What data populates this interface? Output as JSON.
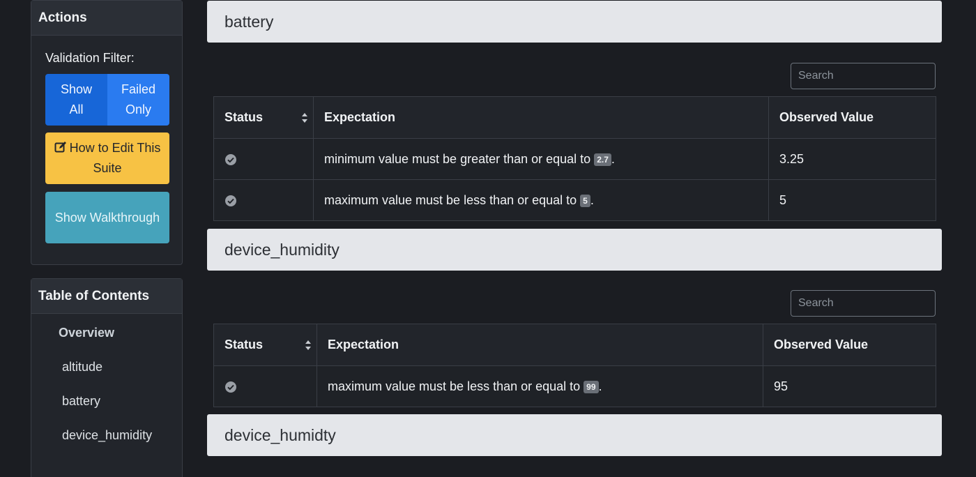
{
  "sidebar": {
    "actions": {
      "title": "Actions",
      "filter_label": "Validation Filter:",
      "show_all_label": "Show\nAll",
      "failed_only_label": "Failed\nOnly",
      "edit_label": "How to Edit This Suite",
      "walkthrough_label": "Show Walkthrough"
    },
    "toc": {
      "title": "Table of Contents",
      "items": [
        {
          "label": "Overview"
        },
        {
          "label": "altitude"
        },
        {
          "label": "battery"
        },
        {
          "label": "device_humidity"
        }
      ]
    }
  },
  "sections": [
    {
      "title": "battery",
      "search_placeholder": "Search",
      "columns": [
        "Status",
        "Expectation",
        "Observed Value"
      ],
      "rows": [
        {
          "status": "success",
          "expectation_prefix": "minimum value must be greater than or equal to ",
          "param": "2.7",
          "expectation_suffix": ".",
          "observed": "3.25"
        },
        {
          "status": "success",
          "expectation_prefix": "maximum value must be less than or equal to ",
          "param": "5",
          "expectation_suffix": ".",
          "observed": "5"
        }
      ]
    },
    {
      "title": "device_humidity",
      "search_placeholder": "Search",
      "columns": [
        "Status",
        "Expectation",
        "Observed Value"
      ],
      "rows": [
        {
          "status": "success",
          "expectation_prefix": "maximum value must be less than or equal to ",
          "param": "99",
          "expectation_suffix": ".",
          "observed": "95"
        }
      ]
    },
    {
      "title": "device_humidty"
    }
  ],
  "colors": {
    "background": "#1b1d22",
    "primary": "#1e6fe6",
    "warning": "#f7c244",
    "info": "#46a3bb",
    "section_header": "#e4e6ea"
  }
}
